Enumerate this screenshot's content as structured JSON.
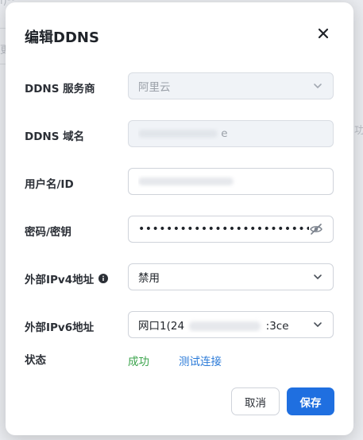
{
  "background": {
    "frag_top": "ı)ᵃᶜ",
    "frag_left": "更",
    "frag_right": "功"
  },
  "dialog": {
    "title": "编辑DDNS",
    "close_icon": "close-icon",
    "fields": {
      "provider": {
        "label": "DDNS 服务商",
        "value": "阿里云"
      },
      "domain": {
        "label": "DDNS 域名",
        "value_prefix": "",
        "value_suffix": "e"
      },
      "username": {
        "label": "用户名/ID",
        "value_prefix": "",
        "value_suffix": ""
      },
      "password": {
        "label": "密码/密钥",
        "value": "••••••••••••••••••••••••••••••"
      },
      "ipv4": {
        "label": "外部IPv4地址",
        "value": "禁用"
      },
      "ipv6": {
        "label": "外部IPv6地址",
        "value_prefix": "网口1(24",
        "value_suffix": ":3ce"
      }
    },
    "status": {
      "label": "状态",
      "value": "成功",
      "test_link": "测试连接"
    },
    "buttons": {
      "cancel": "取消",
      "save": "保存"
    }
  },
  "colors": {
    "primary": "#1f6fe0",
    "success": "#3aa34b",
    "link": "#2a7ad8"
  }
}
